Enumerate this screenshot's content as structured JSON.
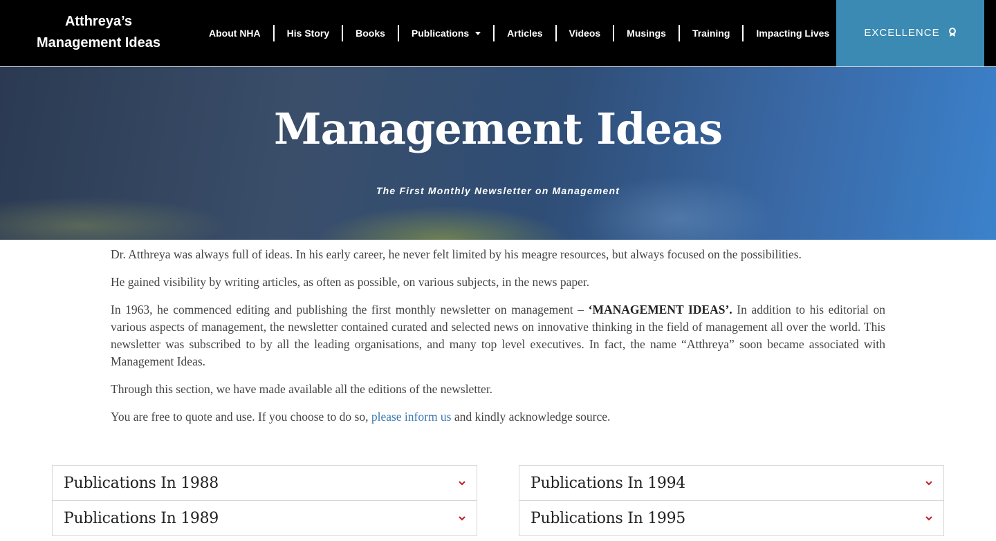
{
  "header": {
    "logo_line1": "Atthreya’s",
    "logo_line2": "Management Ideas",
    "nav": [
      {
        "label": "About NHA"
      },
      {
        "label": "His Story"
      },
      {
        "label": "Books"
      },
      {
        "label": "Publications",
        "has_dropdown": true
      },
      {
        "label": "Articles"
      },
      {
        "label": "Videos"
      },
      {
        "label": "Musings"
      },
      {
        "label": "Training"
      },
      {
        "label": "Impacting Lives"
      }
    ],
    "cta_label": "EXCELLENCE",
    "cta_icon": "award-icon"
  },
  "hero": {
    "title": "Management Ideas",
    "subtitle": "The First Monthly Newsletter on Management"
  },
  "content": {
    "p1": "Dr. Atthreya was always full of ideas. In his early career, he never felt limited by his meagre resources, but always focused on the possibilities.",
    "p2": "He gained visibility by writing articles, as often as possible,  on various subjects,  in the news paper.",
    "p3_start": "In 1963, he commenced editing and publishing the first monthly newsletter on management – ",
    "p3_bold": "‘MANAGEMENT IDEAS’.",
    "p3_end": " In addition to his editorial on various aspects of management, the newsletter contained curated and selected news on innovative thinking in the field of management all over the world. This newsletter was subscribed to by all the leading organisations, and many top level executives. In fact, the name “Atthreya” soon became associated with Management Ideas.",
    "p4": "Through this section, we have made available all the editions of the newsletter.",
    "p5_start": "You are free to quote and use. If you choose to do so, ",
    "p5_link": "please inform us",
    "p5_end": " and kindly acknowledge source."
  },
  "accordions": {
    "left": [
      {
        "title": "Publications In 1988"
      },
      {
        "title": "Publications In 1989"
      }
    ],
    "right": [
      {
        "title": "Publications In 1994"
      },
      {
        "title": "Publications In 1995"
      }
    ]
  },
  "colors": {
    "header_bg": "#000000",
    "cta_bg": "#3a8ab3",
    "link": "#3d78b0",
    "chevron": "#c0272d"
  }
}
